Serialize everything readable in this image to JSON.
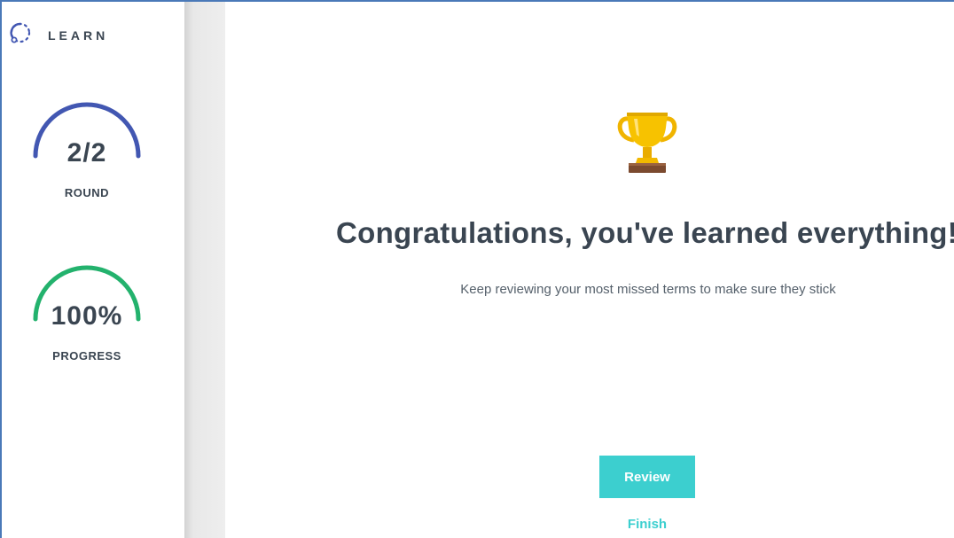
{
  "app": {
    "mode_label": "LEARN"
  },
  "round": {
    "value": "2/2",
    "label": "ROUND",
    "fraction": 1.0,
    "color": "#4257b2"
  },
  "progress": {
    "value": "100%",
    "label": "PROGRESS",
    "fraction": 1.0,
    "color": "#23b26d"
  },
  "main": {
    "icon": "trophy-icon",
    "title": "Congratulations, you've learned everything!",
    "subtitle": "Keep reviewing your most missed terms to make sure they stick",
    "review_label": "Review",
    "finish_label": "Finish"
  },
  "colors": {
    "accent": "#3ccfcf",
    "text": "#3a4551",
    "frame": "#4a79b8"
  }
}
